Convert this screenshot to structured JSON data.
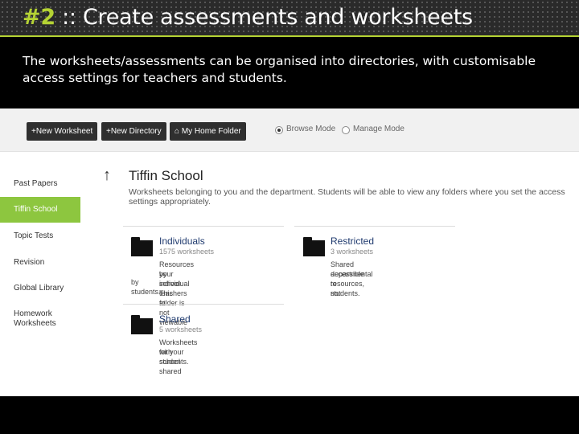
{
  "slide": {
    "title_number": "#2",
    "title_text": " :: Create assessments and worksheets",
    "intro": "The worksheets/assessments can be organised into directories, with customisable access settings for teachers and students."
  },
  "toolbar": {
    "new_worksheet": "+New Worksheet",
    "new_directory": "+New Directory",
    "home_folder": "My Home Folder",
    "browse_mode": "Browse Mode",
    "manage_mode": "Manage Mode"
  },
  "sidebar": {
    "items": [
      {
        "label": "Past Papers"
      },
      {
        "label": "Tiffin School",
        "active": true
      },
      {
        "label": "Topic Tests"
      },
      {
        "label": "Revision"
      },
      {
        "label": "Global Library"
      },
      {
        "label": "Homework"
      },
      {
        "label": "Worksheets"
      }
    ]
  },
  "main": {
    "back_arrow": "↑",
    "folder_title": "Tiffin School",
    "folder_desc": "Worksheets belonging to you and the department. Students will be able to view any folders where you set the access settings appropriately.",
    "cards": [
      {
        "name": "Individuals",
        "count": "1575 worksheets",
        "desc_line1": "Resources by individual teachers at",
        "desc_line2": "your school. This folder is not viewable",
        "desc_line3": "by students."
      },
      {
        "name": "Restricted",
        "count": "3 worksheets",
        "desc_line1": "Shared departmental resources, not",
        "desc_line2": "accessible to students."
      },
      {
        "name": "Shared",
        "count": "5 worksheets",
        "desc_line1": "Worksheets for your school shared",
        "desc_line2": "with students."
      }
    ]
  },
  "colors": {
    "accent": "#b5d334",
    "sidebar_active": "#8dc63f",
    "button_dark": "#2f2f2f"
  }
}
